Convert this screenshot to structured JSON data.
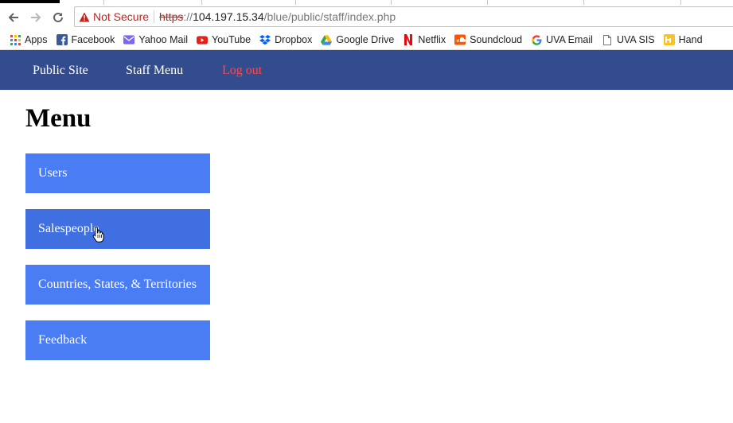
{
  "browser": {
    "security_label": "Not Secure",
    "url_scheme": "https",
    "url_sep": "://",
    "url_host": "104.197.15.34",
    "url_path": "/blue/public/staff/index.php"
  },
  "bookmarks": [
    {
      "label": "Apps",
      "icon": "apps-grid-icon"
    },
    {
      "label": "Facebook",
      "icon": "facebook-icon"
    },
    {
      "label": "Yahoo Mail",
      "icon": "yahoo-mail-icon"
    },
    {
      "label": "YouTube",
      "icon": "youtube-icon"
    },
    {
      "label": "Dropbox",
      "icon": "dropbox-icon"
    },
    {
      "label": "Google Drive",
      "icon": "google-drive-icon"
    },
    {
      "label": "Netflix",
      "icon": "netflix-icon"
    },
    {
      "label": "Soundcloud",
      "icon": "soundcloud-icon"
    },
    {
      "label": "UVA Email",
      "icon": "google-g-icon"
    },
    {
      "label": "UVA SIS",
      "icon": "page-icon"
    },
    {
      "label": "Hand",
      "icon": "handshake-icon"
    }
  ],
  "nav": {
    "public_site": "Public Site",
    "staff_menu": "Staff Menu",
    "logout": "Log out"
  },
  "main": {
    "title": "Menu",
    "items": [
      {
        "label": "Users"
      },
      {
        "label": "Salespeople"
      },
      {
        "label": "Countries, States, & Territories"
      },
      {
        "label": "Feedback"
      }
    ]
  },
  "colors": {
    "nav_bg": "#334c8e",
    "menu_item_bg": "#4a7cf4",
    "logout": "#ff4a4a",
    "not_secure": "#c5221f"
  }
}
